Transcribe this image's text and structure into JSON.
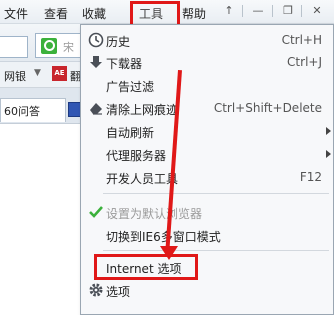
{
  "menubar": {
    "items": [
      {
        "label": "文件"
      },
      {
        "label": "查看"
      },
      {
        "label": "收藏"
      },
      {
        "label": "工具"
      },
      {
        "label": "帮助"
      }
    ]
  },
  "window_controls": [
    "↑",
    "—",
    "❐",
    "✕"
  ],
  "toolbar": {
    "search_placeholder": "宋"
  },
  "bookmarks": {
    "item_1": "网银",
    "item_1_arrow": "▼",
    "item_2_icon": "AE",
    "item_2": "翻"
  },
  "tabs": {
    "active_label": "60问答"
  },
  "tools_menu": {
    "items": [
      {
        "label": "历史",
        "shortcut": "Ctrl+H"
      },
      {
        "label": "下载器",
        "shortcut": "Ctrl+J"
      },
      {
        "label": "广告过滤",
        "shortcut": ""
      },
      {
        "label": "清除上网痕迹",
        "shortcut": "Ctrl+Shift+Delete"
      },
      {
        "label": "自动刷新",
        "shortcut": ""
      },
      {
        "label": "代理服务器",
        "shortcut": ""
      },
      {
        "label": "开发人员工具",
        "shortcut": "F12"
      },
      {
        "label": "设置为默认浏览器",
        "shortcut": ""
      },
      {
        "label": "切换到IE6多窗口模式",
        "shortcut": ""
      },
      {
        "label": "Internet 选项",
        "shortcut": ""
      },
      {
        "label": "选项",
        "shortcut": ""
      }
    ]
  },
  "colors": {
    "highlight": "#e01818",
    "check": "#3bb13b"
  }
}
